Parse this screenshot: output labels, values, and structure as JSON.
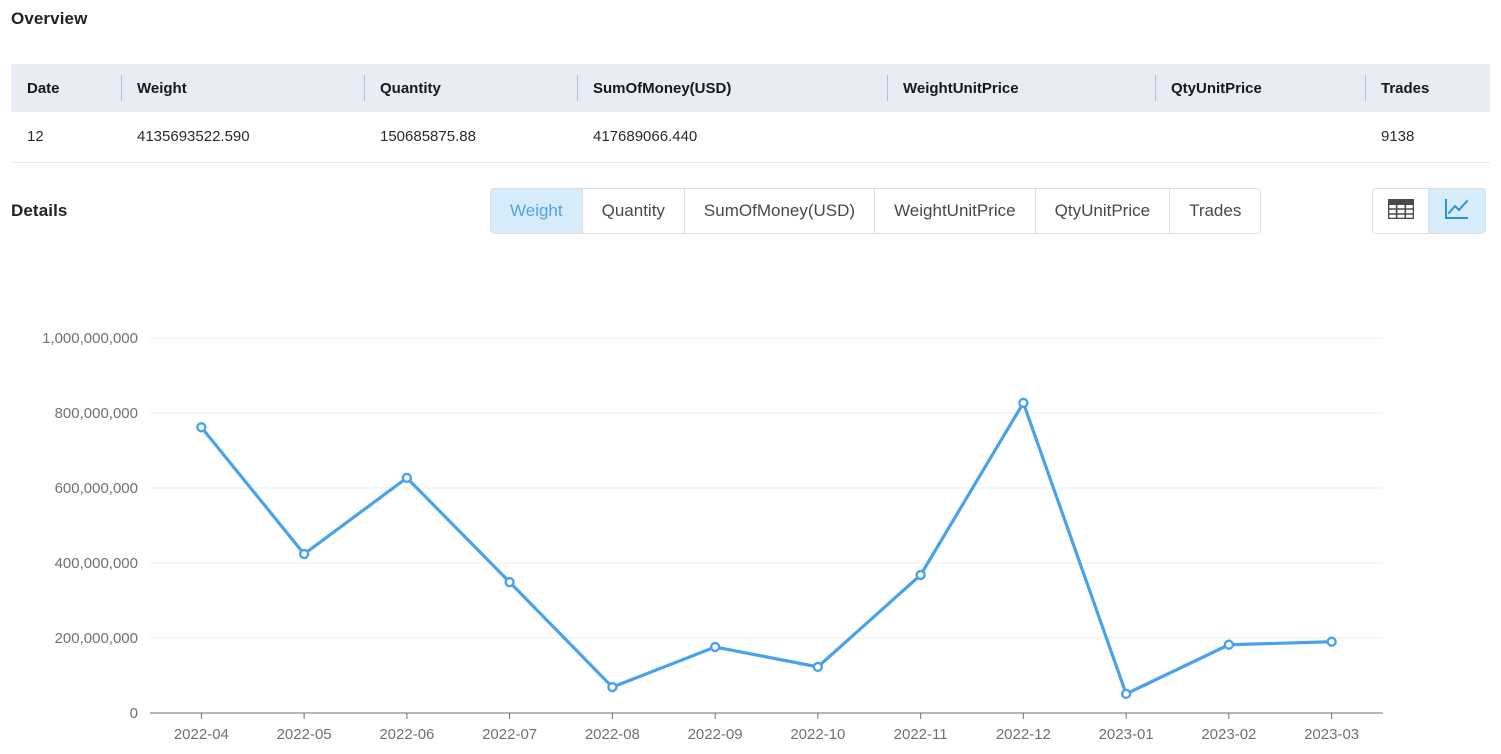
{
  "overview": {
    "title": "Overview",
    "columns": [
      "Date",
      "Weight",
      "Quantity",
      "SumOfMoney(USD)",
      "WeightUnitPrice",
      "QtyUnitPrice",
      "Trades"
    ],
    "rows": [
      {
        "date": "12",
        "weight": "4135693522.590",
        "quantity": "150685875.88",
        "sum_of_money": "417689066.440",
        "weight_unit_price": "",
        "qty_unit_price": "",
        "trades": "9138"
      }
    ]
  },
  "details": {
    "title": "Details",
    "tabs": [
      {
        "label": "Weight",
        "active": true
      },
      {
        "label": "Quantity",
        "active": false
      },
      {
        "label": "SumOfMoney(USD)",
        "active": false
      },
      {
        "label": "WeightUnitPrice",
        "active": false
      },
      {
        "label": "QtyUnitPrice",
        "active": false
      },
      {
        "label": "Trades",
        "active": false
      }
    ],
    "view_toggle": [
      {
        "icon": "table-view-icon",
        "active": false
      },
      {
        "icon": "chart-view-icon",
        "active": true
      }
    ]
  },
  "colors": {
    "accent": "#4ba2ec",
    "accent_bg": "#d6ecfa",
    "table_header_bg": "#e8ecf5",
    "gridline": "#e9ecf5",
    "axis": "#6b6f76"
  },
  "chart_data": {
    "type": "line",
    "title": "",
    "xlabel": "",
    "ylabel": "",
    "grid": true,
    "legend": false,
    "ylim": [
      0,
      1000000000
    ],
    "yticks": [
      0,
      200000000,
      400000000,
      600000000,
      800000000,
      1000000000
    ],
    "ytick_labels": [
      "0",
      "200,000,000",
      "400,000,000",
      "600,000,000",
      "800,000,000",
      "1,000,000,000"
    ],
    "categories": [
      "2022-04",
      "2022-05",
      "2022-06",
      "2022-07",
      "2022-08",
      "2022-09",
      "2022-10",
      "2022-11",
      "2022-12",
      "2023-01",
      "2023-02",
      "2023-03"
    ],
    "series": [
      {
        "name": "Weight",
        "color": "#4ba2ec",
        "values": [
          762000000,
          424000000,
          627000000,
          349000000,
          69000000,
          176000000,
          123000000,
          368000000,
          827000000,
          51000000,
          182000000,
          190000000
        ]
      }
    ]
  }
}
